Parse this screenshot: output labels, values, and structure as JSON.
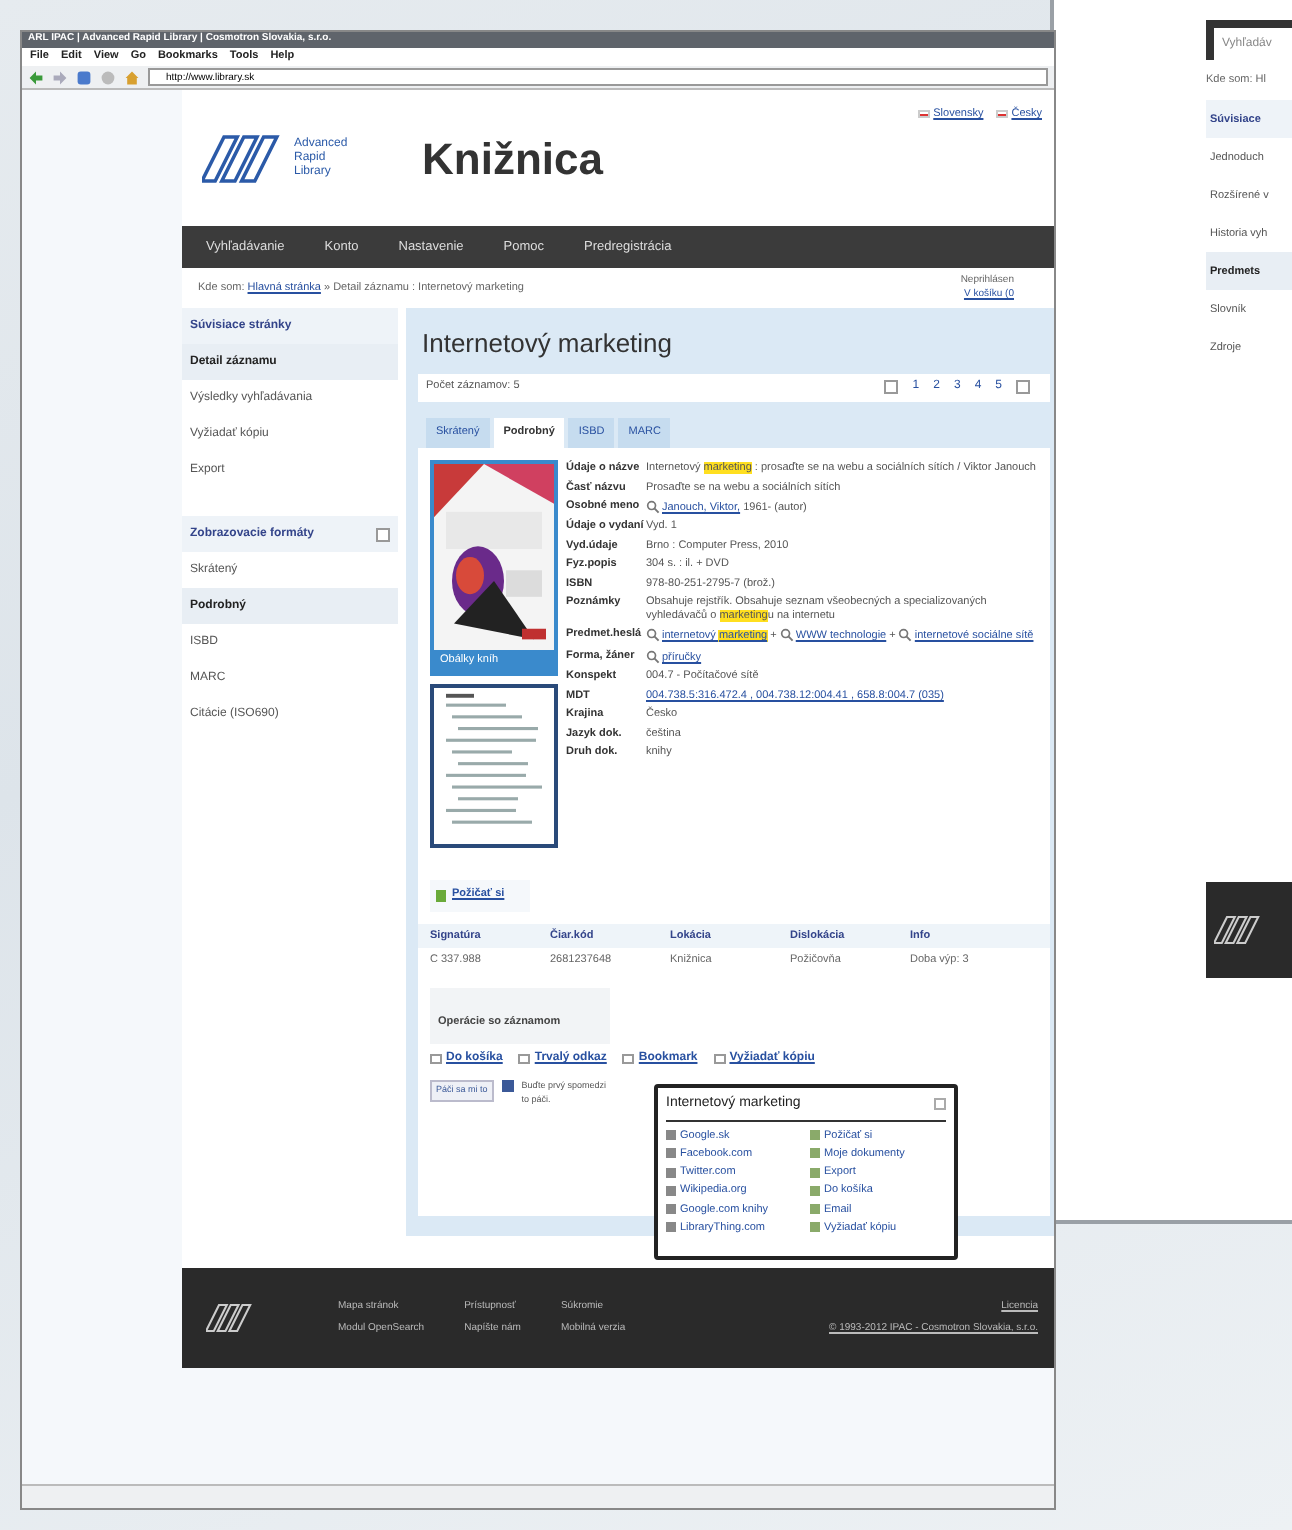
{
  "browser": {
    "title": "ARL IPAC | Advanced Rapid Library | Cosmotron Slovakia, s.r.o.",
    "menu": [
      "File",
      "Edit",
      "View",
      "Go",
      "Bookmarks",
      "Tools",
      "Help"
    ],
    "address": "http://www.library.sk"
  },
  "site": {
    "logo_text": [
      "Advanced",
      "Rapid",
      "Library"
    ],
    "title": "Knižnica",
    "languages": [
      "Slovensky",
      "Česky"
    ],
    "nav": [
      "Vyhľadávanie",
      "Konto",
      "Nastavenie",
      "Pomoc",
      "Predregistrácia"
    ],
    "breadcrumb": {
      "prefix": "Kde som:",
      "home": "Hlavná stránka",
      "rest": "» Detail záznamu : Internetový marketing"
    },
    "user": {
      "status": "Neprihlásen",
      "cart": "V košíku (0"
    },
    "sidebar": [
      {
        "heading": "Súvisiace stránky",
        "items": [
          {
            "label": "Detail záznamu",
            "selected": true
          },
          {
            "label": "Výsledky vyhľadávania",
            "selected": false
          },
          {
            "label": "Vyžiadať kópiu",
            "selected": false
          },
          {
            "label": "Export",
            "selected": false
          }
        ]
      },
      {
        "heading": "Zobrazovacie formáty",
        "items": [
          {
            "label": "Skrátený",
            "selected": false
          },
          {
            "label": "Podrobný",
            "selected": true
          },
          {
            "label": "ISBD",
            "selected": false
          },
          {
            "label": "MARC",
            "selected": false
          },
          {
            "label": "Citácie (ISO690)",
            "selected": false
          }
        ]
      }
    ],
    "record": {
      "title": "Internetový marketing",
      "count": "Počet záznamov: 5",
      "pages": [
        "1",
        "2",
        "3",
        "4",
        "5"
      ],
      "tabs": [
        {
          "label": "Skrátený",
          "selected": false
        },
        {
          "label": "Podrobný",
          "selected": true
        },
        {
          "label": "ISBD",
          "selected": false
        },
        {
          "label": "MARC",
          "selected": false
        }
      ],
      "covers_button": "Obálky kníh",
      "fields": [
        {
          "label": "Údaje o názve",
          "value": [
            {
              "kind": "text",
              "text": "Internetový "
            },
            {
              "kind": "mark",
              "text": "marketing"
            },
            {
              "kind": "text",
              "text": " : prosaďte se na webu a sociálních sítích / Viktor Janouch"
            }
          ]
        },
        {
          "label": "Časť názvu",
          "value": [
            {
              "kind": "text",
              "text": "Prosaďte se na webu a sociálních sítích"
            }
          ]
        },
        {
          "label": "Osobné meno",
          "value": [
            {
              "kind": "search-link",
              "text": "Janouch, Viktor,"
            },
            {
              "kind": "text",
              "text": " 1961- (autor)"
            }
          ]
        },
        {
          "label": "Údaje o vydaní",
          "value": [
            {
              "kind": "text",
              "text": "Vyd. 1"
            }
          ]
        },
        {
          "label": "Vyd.údaje",
          "value": [
            {
              "kind": "text",
              "text": "Brno : Computer Press, 2010"
            }
          ]
        },
        {
          "label": "Fyz.popis",
          "value": [
            {
              "kind": "text",
              "text": "304 s. : il. + DVD"
            }
          ]
        },
        {
          "label": "ISBN",
          "value": [
            {
              "kind": "text",
              "text": "978-80-251-2795-7 (brož.)"
            }
          ]
        },
        {
          "label": "Poznámky",
          "value": [
            {
              "kind": "text",
              "text": "Obsahuje rejstřík. Obsahuje seznam všeobecných a specializovaných vyhledávačů o "
            },
            {
              "kind": "mark",
              "text": "marketing"
            },
            {
              "kind": "text",
              "text": "u na internetu"
            }
          ]
        },
        {
          "label": "Predmet.heslá",
          "value": [
            {
              "kind": "search-link",
              "text": "internetový "
            },
            {
              "kind": "link-mark",
              "text": "marketing"
            },
            {
              "kind": "text",
              "text": " + "
            },
            {
              "kind": "search-link",
              "text": "WWW technologie"
            },
            {
              "kind": "text",
              "text": " + "
            },
            {
              "kind": "search-link",
              "text": "internetové sociálne sítě"
            }
          ]
        },
        {
          "label": "Forma, žáner",
          "value": [
            {
              "kind": "search-link",
              "text": "příručky"
            }
          ]
        },
        {
          "label": "Konspekt",
          "value": [
            {
              "kind": "text",
              "text": "004.7 - Počítačové sítě"
            }
          ]
        },
        {
          "label": "MDT",
          "value": [
            {
              "kind": "link",
              "text": "004.738.5:316.472.4 , 004.738.12:004.41 , 658.8:004.7 (035)"
            }
          ]
        },
        {
          "label": "Krajina",
          "value": [
            {
              "kind": "text",
              "text": "Česko"
            }
          ]
        },
        {
          "label": "Jazyk dok.",
          "value": [
            {
              "kind": "text",
              "text": "čeština"
            }
          ]
        },
        {
          "label": "Druh dok.",
          "value": [
            {
              "kind": "text",
              "text": "knihy"
            }
          ]
        }
      ],
      "borrow": "Požičať si",
      "holdings": {
        "columns": [
          "Signatúra",
          "Čiar.kód",
          "Lokácia",
          "Dislokácia",
          "Info"
        ],
        "rows": [
          [
            "C 337.988",
            "2681237648",
            "Knižnica",
            "Požičovňa",
            "Doba výp: 3"
          ]
        ]
      },
      "operations": {
        "heading": "Operácie so záznamom",
        "links": [
          "Do košíka",
          "Trvalý odkaz",
          "Bookmark",
          "Vyžiadať kópiu"
        ],
        "like": "Páči sa mi to",
        "like_note": [
          "Buďte prvý spomedzi",
          "to páči."
        ]
      },
      "popup": {
        "title": "Internetový marketing",
        "left": [
          "Google.sk",
          "Facebook.com",
          "Twitter.com",
          "Wikipedia.org",
          "Google.com knihy",
          "LibraryThing.com"
        ],
        "right": [
          "Požičať si",
          "Moje dokumenty",
          "Export",
          "Do košíka",
          "Email",
          "Vyžiadať kópiu"
        ]
      }
    },
    "footer": {
      "columns": [
        [
          "Mapa stránok",
          "Modul OpenSearch"
        ],
        [
          "Prístupnosť",
          "Napíšte nám"
        ],
        [
          "Súkromie",
          "Mobilná verzia"
        ]
      ],
      "right": [
        "Licencia",
        "© 1993-2012 IPAC - Cosmotron Slovakia, s.r.o."
      ]
    }
  },
  "second_window": {
    "nav": "Vyhľadáv",
    "breadcrumb": "Kde som: Hl",
    "items": [
      {
        "label": "Súvisiace",
        "kind": "heading"
      },
      {
        "label": "Jednoduch",
        "kind": "item"
      },
      {
        "label": "Rozšírené v",
        "kind": "item"
      },
      {
        "label": "Historia vyh",
        "kind": "item"
      },
      {
        "label": "Predmets",
        "kind": "selected"
      },
      {
        "label": "Slovník",
        "kind": "item"
      },
      {
        "label": "Zdroje",
        "kind": "item"
      }
    ]
  }
}
